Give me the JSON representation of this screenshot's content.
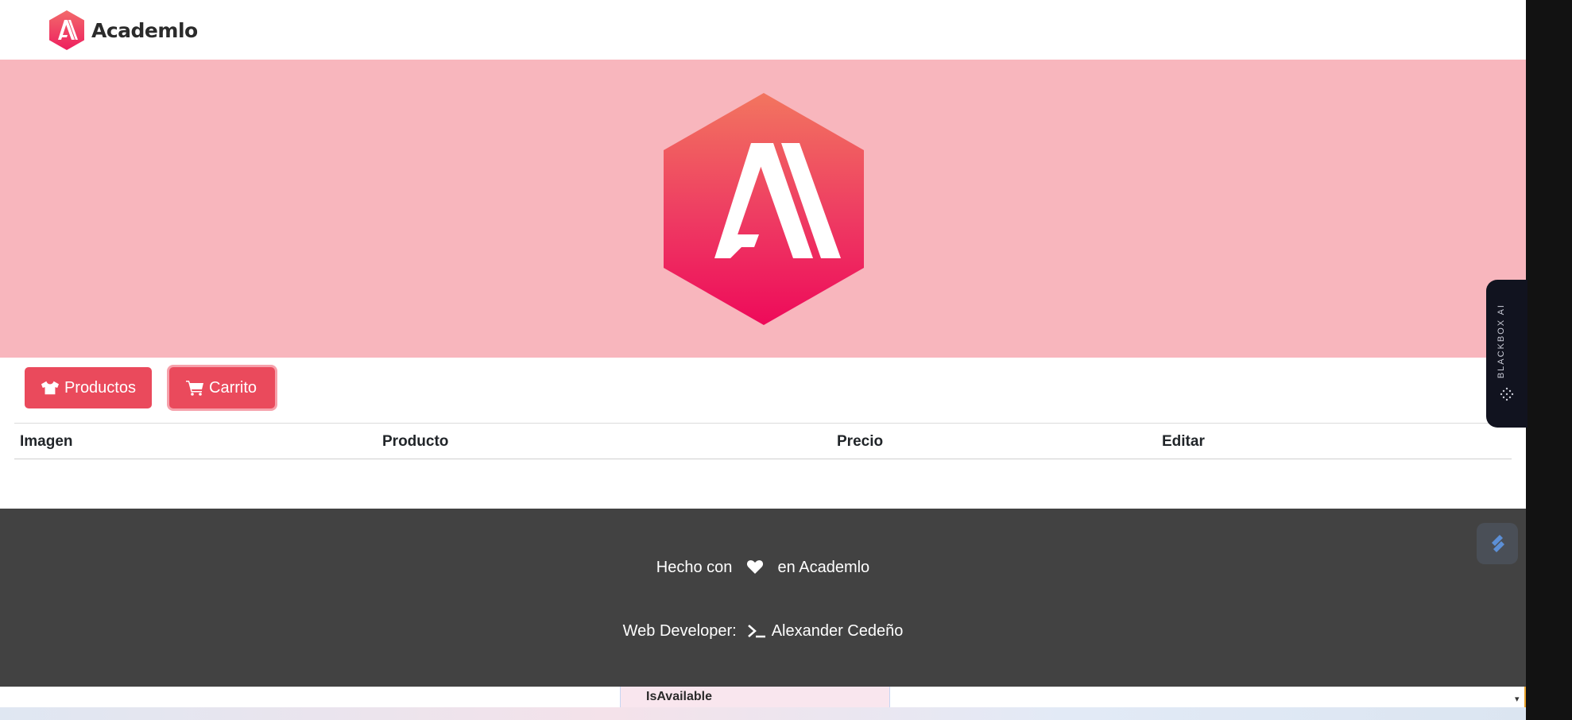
{
  "brand": {
    "name": "Academlo",
    "logo_icon": "academlo-logo-icon"
  },
  "hero": {
    "logo_icon": "academlo-hex-logo-icon"
  },
  "nav_buttons": [
    {
      "label": "Productos",
      "icon": "shirt-icon"
    },
    {
      "label": "Carrito",
      "icon": "cart-icon"
    }
  ],
  "table": {
    "columns": [
      "Imagen",
      "Producto",
      "Precio",
      "Editar"
    ],
    "rows": []
  },
  "footer": {
    "made_with": "Hecho con",
    "made_at": "en Academlo",
    "developer_label": "Web Developer:",
    "developer_name": "Alexander Cedeño"
  },
  "side_panel": {
    "label": "BLACKBOX AI"
  },
  "devtools_strip": {
    "field_label": "IsAvailable"
  },
  "colors": {
    "accent": "#ea4a5c",
    "hero_bg": "#f8b6bd",
    "footer_bg": "#424242"
  }
}
